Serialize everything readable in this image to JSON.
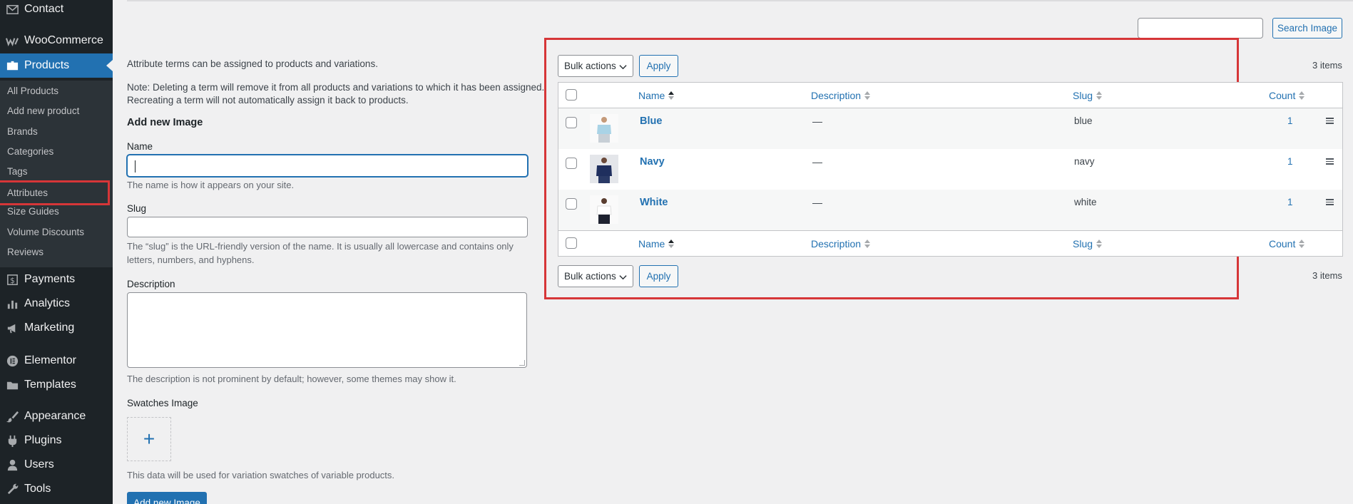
{
  "sidebar": {
    "top_items": [
      {
        "label": "Contact",
        "icon": "mail-icon"
      },
      {
        "label": "WooCommerce",
        "icon": "woocommerce-icon"
      },
      {
        "label": "Products",
        "icon": "products-icon"
      }
    ],
    "submenu": [
      "All Products",
      "Add new product",
      "Brands",
      "Categories",
      "Tags",
      "Attributes",
      "Size Guides",
      "Volume Discounts",
      "Reviews"
    ],
    "bottom_items": [
      {
        "label": "Payments",
        "icon": "payments-icon"
      },
      {
        "label": "Analytics",
        "icon": "analytics-icon"
      },
      {
        "label": "Marketing",
        "icon": "marketing-icon"
      },
      {
        "label": "Elementor",
        "icon": "elementor-icon"
      },
      {
        "label": "Templates",
        "icon": "folder-icon"
      },
      {
        "label": "Appearance",
        "icon": "brush-icon"
      },
      {
        "label": "Plugins",
        "icon": "plugin-icon"
      },
      {
        "label": "Users",
        "icon": "users-icon"
      },
      {
        "label": "Tools",
        "icon": "wrench-icon"
      }
    ]
  },
  "search": {
    "placeholder": "",
    "button": "Search Image"
  },
  "form": {
    "intro": "Attribute terms can be assigned to products and variations.",
    "note_line1": "Note: Deleting a term will remove it from all products and variations to which it has been assigned.",
    "note_line2": "Recreating a term will not automatically assign it back to products.",
    "heading": "Add new Image",
    "name_label": "Name",
    "name_help": "The name is how it appears on your site.",
    "slug_label": "Slug",
    "slug_help_line1": "The “slug” is the URL-friendly version of the name. It is usually all lowercase and contains only",
    "slug_help_line2": "letters, numbers, and hyphens.",
    "description_label": "Description",
    "description_help": "The description is not prominent by default; however, some themes may show it.",
    "swatch_label": "Swatches Image",
    "swatch_plus": "+",
    "swatch_help": "This data will be used for variation swatches of variable products.",
    "submit": "Add new Image"
  },
  "table": {
    "bulk_actions": "Bulk actions",
    "apply": "Apply",
    "items_count": "3 items",
    "columns": {
      "name": "Name",
      "description": "Description",
      "slug": "Slug",
      "count": "Count"
    },
    "rows": [
      {
        "name": "Blue",
        "description": "—",
        "slug": "blue",
        "count": "1",
        "shirt_color": "#a9d3e6",
        "pants_color": "#c7cfd6"
      },
      {
        "name": "Navy",
        "description": "—",
        "slug": "navy",
        "count": "1",
        "shirt_color": "#1f2f5e",
        "pants_color": "#2a3a66"
      },
      {
        "name": "White",
        "description": "—",
        "slug": "white",
        "count": "1",
        "shirt_color": "#ffffff",
        "pants_color": "#1e2230"
      }
    ]
  },
  "colors": {
    "accent": "#2271b1",
    "sidebar_bg": "#1d2327",
    "highlight": "#d63638"
  }
}
